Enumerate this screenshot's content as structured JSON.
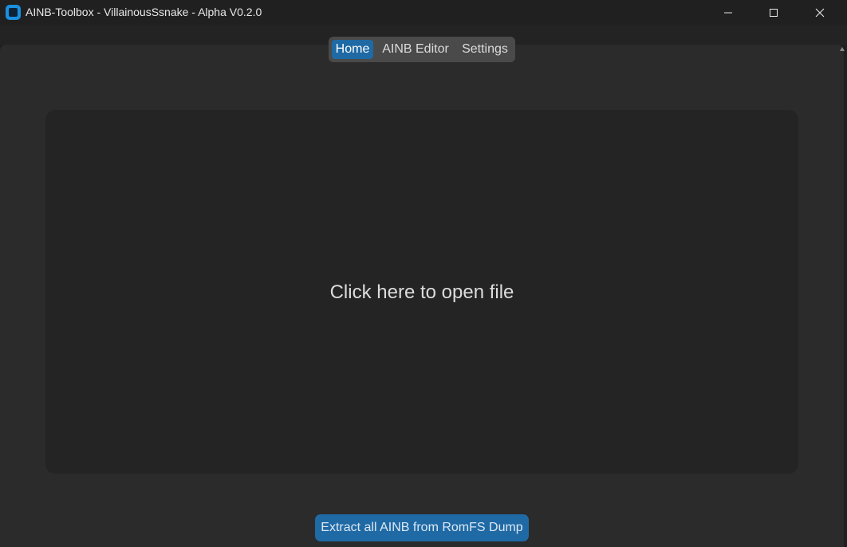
{
  "window": {
    "title": "AINB-Toolbox - VillainousSsnake - Alpha V0.2.0",
    "icon": "app-icon",
    "controls": [
      "minimize-icon",
      "maximize-icon",
      "close-icon"
    ]
  },
  "tabs": [
    {
      "label": "Home",
      "active": true
    },
    {
      "label": "AINB Editor",
      "active": false
    },
    {
      "label": "Settings",
      "active": false
    }
  ],
  "main": {
    "open_file_label": "Click here to open file",
    "extract_button_label": "Extract all AINB from RomFS Dump"
  },
  "colors": {
    "accent": "#1f6aa5",
    "app_icon": "#1a8fe0",
    "background": "#2b2b2b",
    "panel": "#242424"
  }
}
